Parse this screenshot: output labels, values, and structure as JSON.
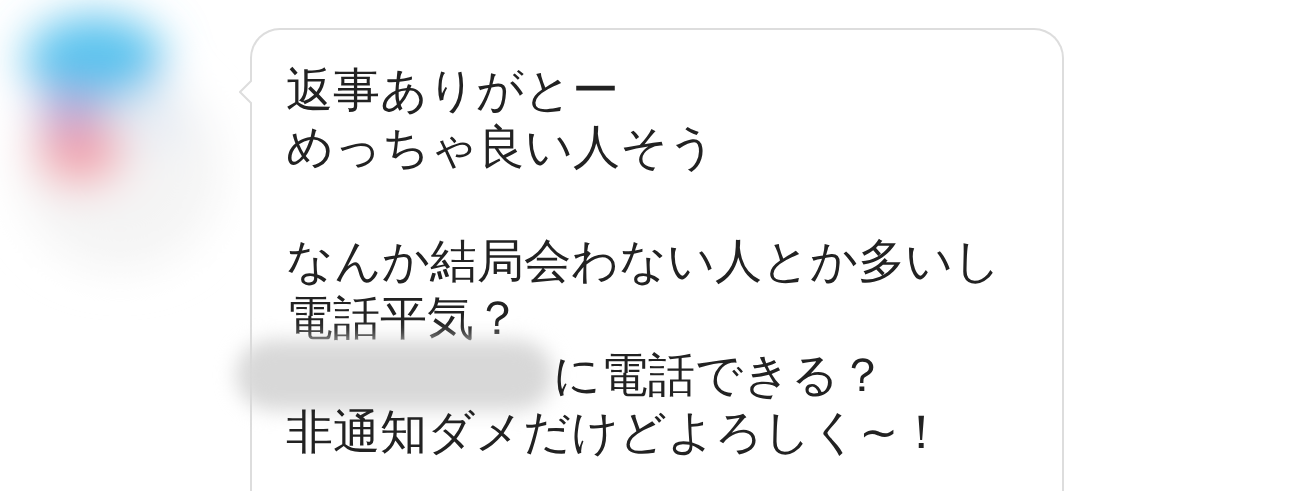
{
  "message": {
    "paragraphs": [
      {
        "lines": [
          {
            "text": "返事ありがとー",
            "redacted": false
          },
          {
            "text": "めっちゃ良い人そう",
            "redacted": false
          }
        ]
      },
      {
        "lines": [
          {
            "text": "なんか結局会わない人とか多いし",
            "redacted": false
          },
          {
            "text": "電話平気？",
            "redacted": false
          },
          {
            "text": "に電話できる？",
            "redacted": true
          },
          {
            "text": "非通知ダメだけどよろしく~！",
            "redacted": false
          }
        ]
      }
    ]
  }
}
